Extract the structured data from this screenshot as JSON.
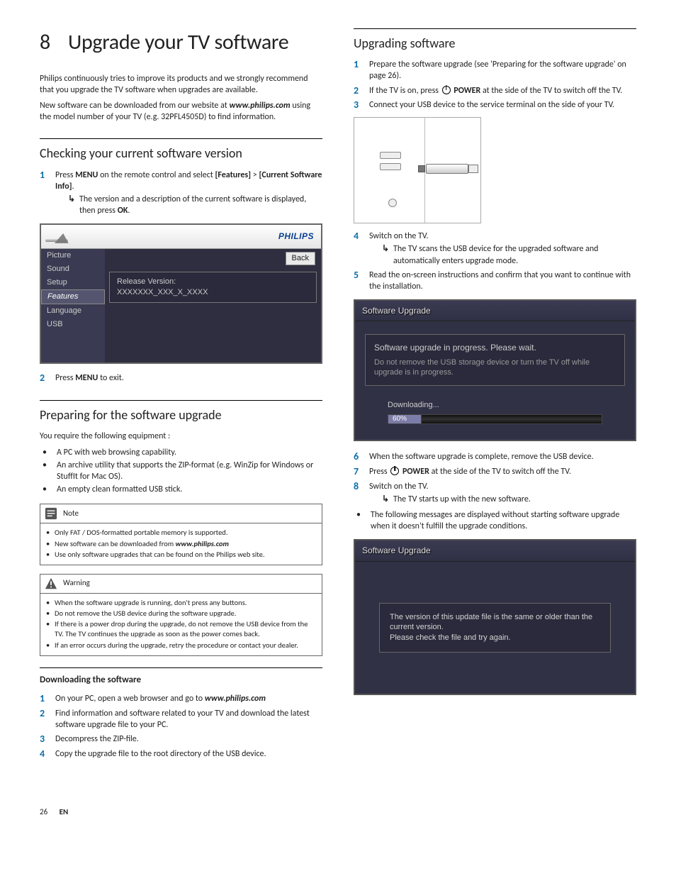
{
  "chapter": {
    "num": "8",
    "title": "Upgrade your TV software"
  },
  "intro": {
    "p1": "Philips continuously tries to improve its products and we strongly recommend that you upgrade the TV software when upgrades are available.",
    "p2a": "New software can be downloaded from our website at ",
    "url": "www.philips.com",
    "p2b": " using the model number of your TV (e.g. 32PFL4505D) to find information."
  },
  "checking": {
    "heading": "Checking your current software version",
    "step1a": "Press ",
    "step1b": "MENU",
    "step1c": " on the remote control and select ",
    "step1d": "[Features]",
    "step1e": " > ",
    "step1f": "[Current Software Info]",
    "step1g": ".",
    "sub1a": "The version and a description of the current software is displayed, then press ",
    "sub1b": "OK",
    "sub1c": ".",
    "step2a": "Press ",
    "step2b": "MENU",
    "step2c": " to exit."
  },
  "osd1": {
    "brand": "PHILIPS",
    "menu": [
      "Picture",
      "Sound",
      "Setup",
      "Features",
      "Language",
      "USB"
    ],
    "active_idx": 3,
    "back": "Back",
    "box_l1": "Release Version:",
    "box_l2": "XXXXXXX_XXX_X_XXXX"
  },
  "preparing": {
    "heading": "Preparing for the software upgrade",
    "intro": "You require the following equipment :",
    "bullets": [
      "A PC with web browsing capability.",
      "An archive utility that supports the ZIP-format (e.g. WinZip for Windows or StuffIt for Mac OS).",
      "An empty clean formatted USB stick."
    ]
  },
  "note": {
    "title": "Note",
    "items_a": "Only FAT / DOS-formatted portable memory is supported.",
    "items_b1": "New software can be downloaded from ",
    "items_b2": "www.philips.com",
    "items_c": "Use only software upgrades that can be found on the Philips web site."
  },
  "warning": {
    "title": "Warning",
    "items": [
      "When the software upgrade is running, don't press any buttons.",
      "Do not remove the USB device during the software upgrade.",
      "If there is a power drop during the upgrade, do not remove the USB device from the TV. The TV continues the upgrade as soon as the power comes back.",
      "If an error occurs during the upgrade, retry the procedure or contact your dealer."
    ]
  },
  "downloading": {
    "heading": "Downloading the software",
    "step1a": "On your PC, open a web browser and go to ",
    "step1b": "www.philips.com",
    "step2": "Find information and software related to your TV and download the latest software upgrade file to your PC.",
    "step3": "Decompress the ZIP-file.",
    "step4": "Copy the upgrade file to the root directory of the USB device."
  },
  "upgrading": {
    "heading": "Upgrading software",
    "step1": "Prepare the software upgrade (see 'Preparing for the software upgrade' on page 26).",
    "step2a": "If the TV is on, press ",
    "step2b": "POWER",
    "step2c": " at the side of the TV to switch off the TV.",
    "step3": "Connect your USB device to the service terminal on the side of your TV.",
    "step4": "Switch on the TV.",
    "sub4": "The TV scans the USB device for the upgraded software and automatically enters upgrade mode.",
    "step5": "Read the on-screen instructions and confirm that you want to continue with the installation.",
    "step6": "When the software upgrade is complete, remove the USB device.",
    "step7a": "Press ",
    "step7b": "POWER",
    "step7c": " at the side of the TV to switch off the TV.",
    "step8": "Switch on the TV.",
    "sub8": "The TV starts up with the new software.",
    "postbullet": "The following messages are displayed without starting software upgrade when it doesn't fulfill the upgrade conditions."
  },
  "upgbox1": {
    "title": "Software Upgrade",
    "l1": "Software upgrade in progress. Please wait.",
    "l2": "Do not remove the USB storage device or turn the TV off while upgrade is in progress.",
    "dl": "Downloading...",
    "pct": "60%"
  },
  "upgbox2": {
    "title": "Software Upgrade",
    "l1": "The version of this update file is the same or older than the current version.",
    "l2": "Please check the file and try again."
  },
  "footer": {
    "page": "26",
    "lang": "EN"
  },
  "nums": {
    "n1": "1",
    "n2": "2",
    "n3": "3",
    "n4": "4",
    "n5": "5",
    "n6": "6",
    "n7": "7",
    "n8": "8"
  }
}
